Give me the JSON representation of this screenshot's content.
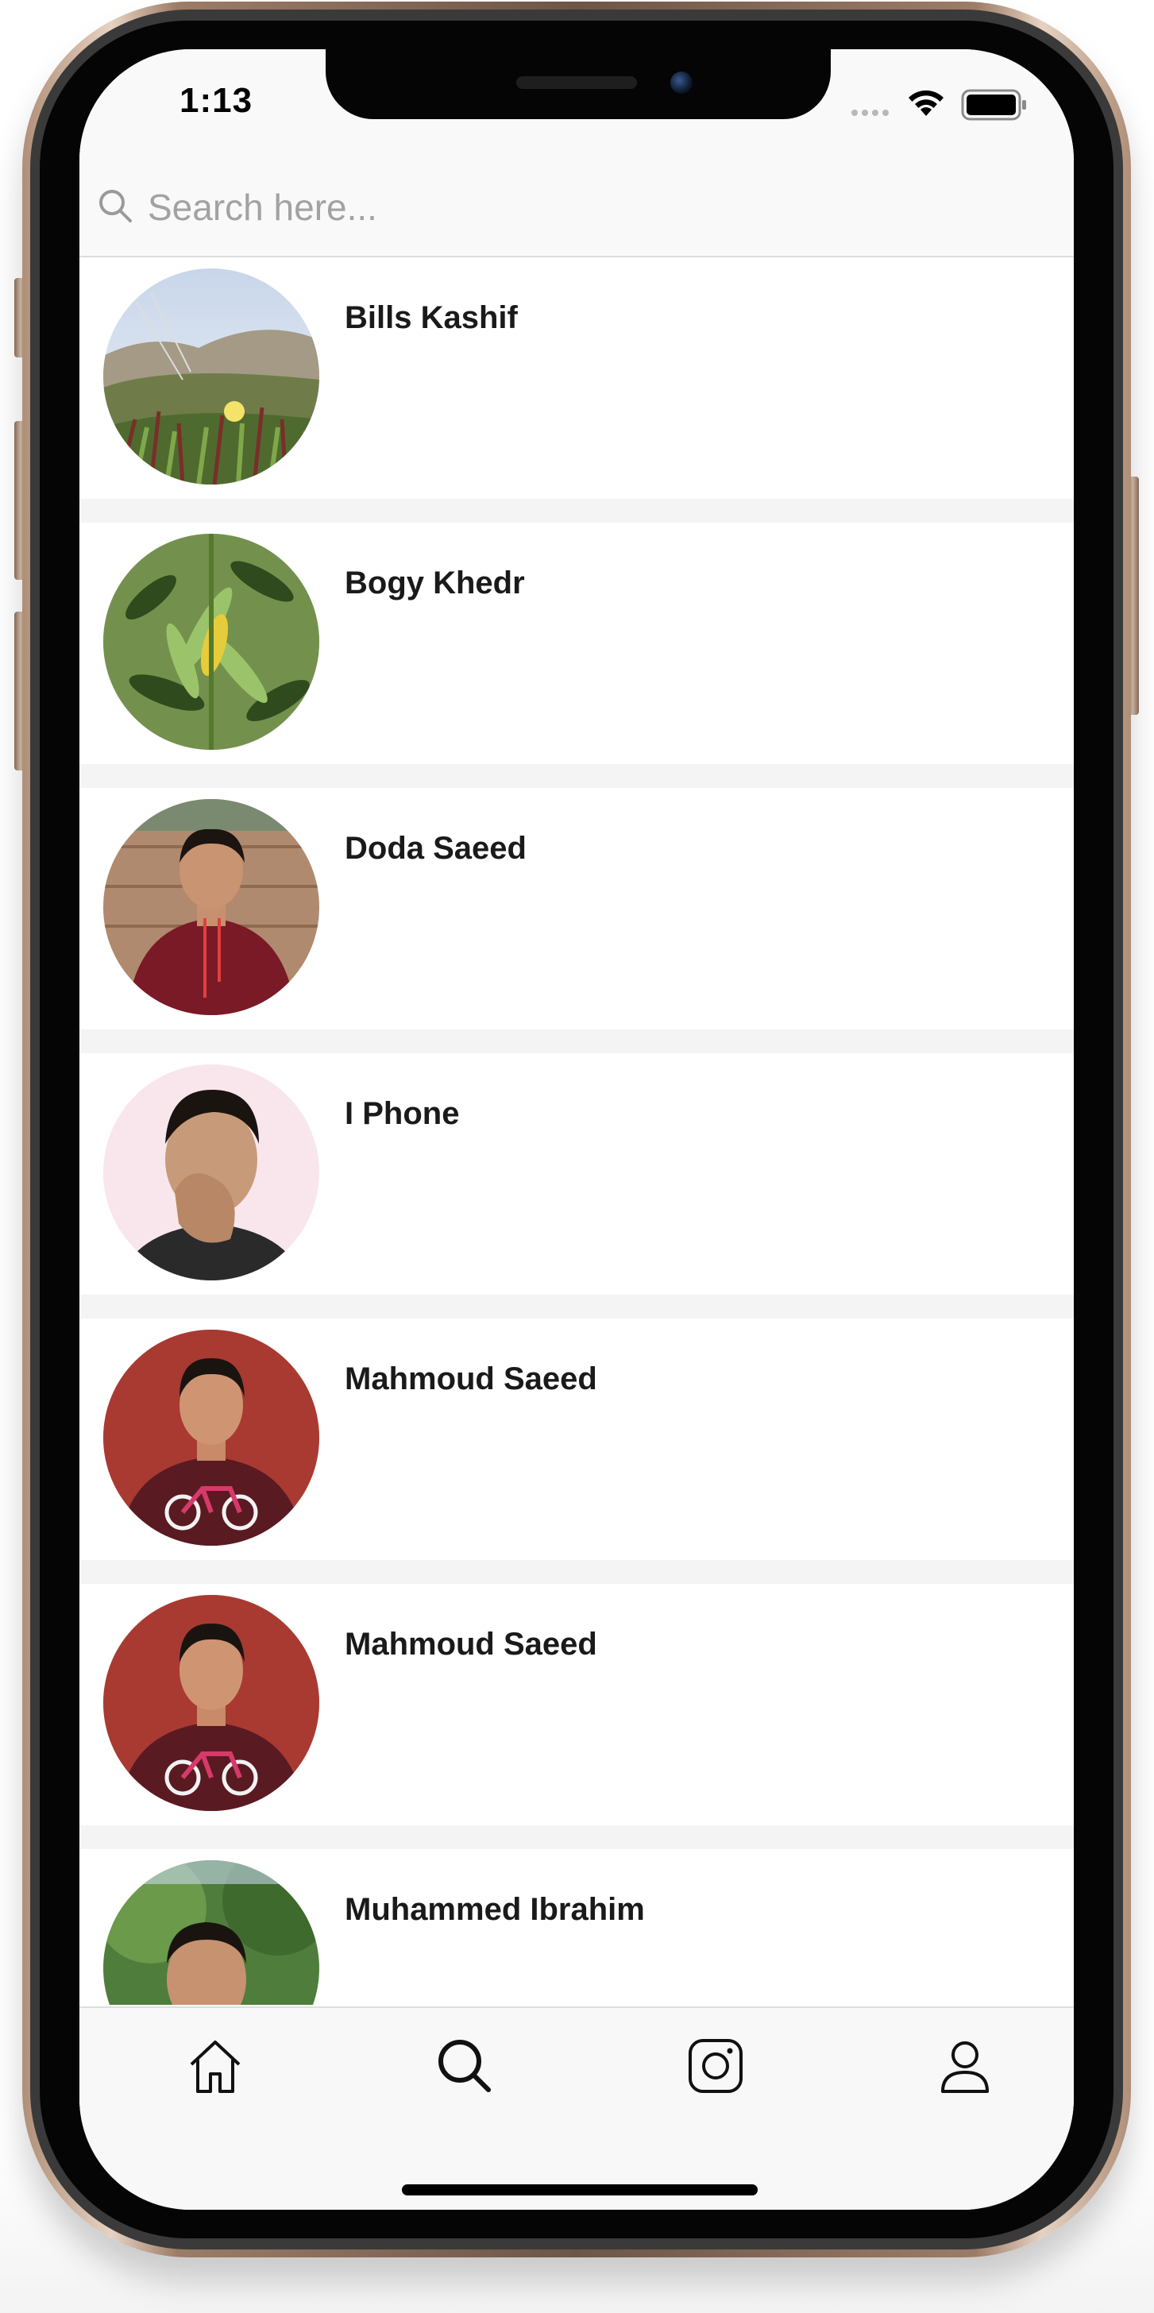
{
  "status_bar": {
    "time": "1:13"
  },
  "search": {
    "placeholder": "Search here..."
  },
  "users": [
    {
      "name": "Bills Kashif",
      "avatar": "landscape-photo"
    },
    {
      "name": "Bogy Khedr",
      "avatar": "plant-photo"
    },
    {
      "name": "Doda Saeed",
      "avatar": "person-photo"
    },
    {
      "name": "I Phone",
      "avatar": "person-photo"
    },
    {
      "name": "Mahmoud Saeed",
      "avatar": "person-photo"
    },
    {
      "name": "Mahmoud Saeed",
      "avatar": "person-photo"
    },
    {
      "name": "Muhammed Ibrahim",
      "avatar": "person-photo"
    }
  ],
  "tab_bar": {
    "tabs": [
      {
        "icon": "home-icon",
        "active": false
      },
      {
        "icon": "search-icon",
        "active": true
      },
      {
        "icon": "instagram-icon",
        "active": false
      },
      {
        "icon": "profile-icon",
        "active": false
      }
    ]
  }
}
